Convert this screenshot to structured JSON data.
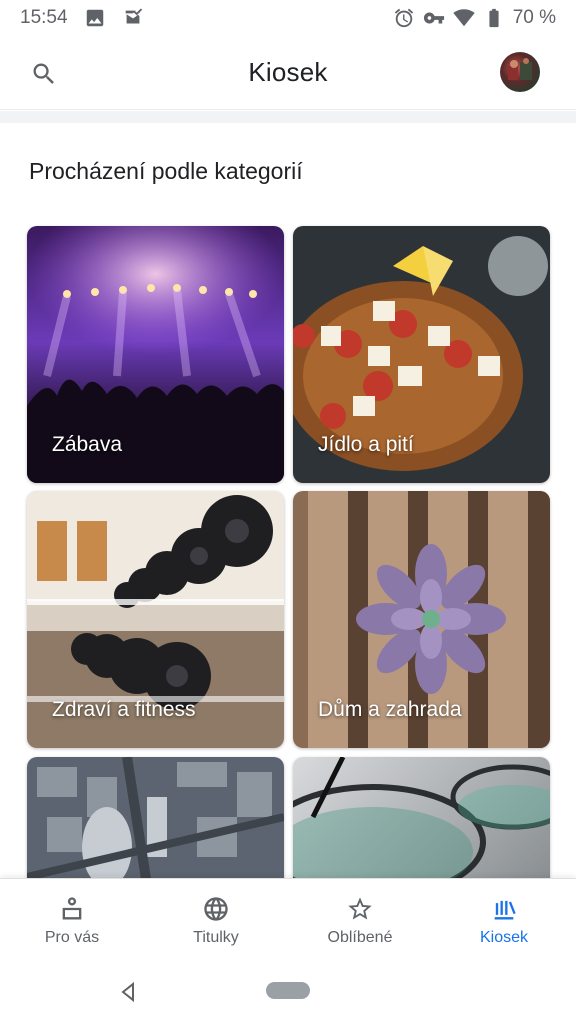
{
  "status_bar": {
    "time": "15:54",
    "battery": "70 %",
    "icons": [
      "image-icon",
      "mail-done-icon",
      "alarm-icon",
      "key-icon",
      "wifi-icon",
      "battery-icon"
    ]
  },
  "app_bar": {
    "title": "Kiosek",
    "search_icon": "search-icon",
    "avatar": "account-avatar"
  },
  "section": {
    "title": "Procházení podle kategorií"
  },
  "categories": [
    {
      "label": "Zábava"
    },
    {
      "label": "Jídlo a pití"
    },
    {
      "label": "Zdraví a fitness"
    },
    {
      "label": "Dům a zahrada"
    },
    {
      "label": ""
    },
    {
      "label": ""
    }
  ],
  "bottom_nav": {
    "items": [
      {
        "label": "Pro vás",
        "icon": "for-you-icon",
        "active": false
      },
      {
        "label": "Titulky",
        "icon": "globe-icon",
        "active": false
      },
      {
        "label": "Oblíbené",
        "icon": "star-icon",
        "active": false
      },
      {
        "label": "Kiosek",
        "icon": "newsstand-icon",
        "active": true
      }
    ]
  },
  "colors": {
    "accent": "#1a73e8",
    "text_primary": "#202124",
    "text_secondary": "#5f6368"
  }
}
